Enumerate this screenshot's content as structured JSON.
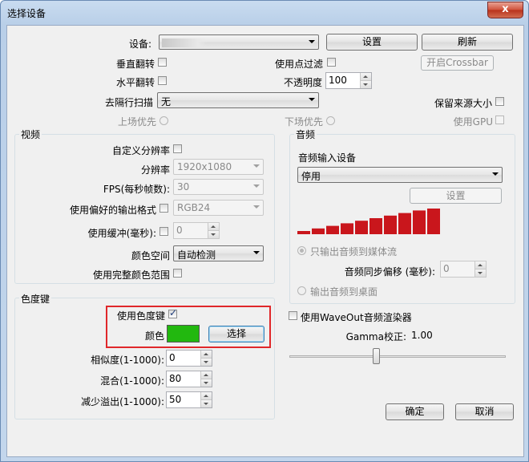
{
  "window": {
    "title": "选择设备",
    "close_glyph": "x"
  },
  "device": {
    "label": "设备:",
    "value": "",
    "settings_button": "设置",
    "refresh_button": "刷新",
    "crossbar_button": "开启Crossbar"
  },
  "options": {
    "flip_vertical": "垂直翻转",
    "flip_horizontal": "水平翻转",
    "use_point_filter": "使用点过滤",
    "opacity_label": "不透明度",
    "opacity_value": "100",
    "deinterlace_label": "去隔行扫描",
    "deinterlace_value": "无",
    "keep_source_size": "保留来源大小",
    "top_field_first": "上场优先",
    "bottom_field_first": "下场优先",
    "use_gpu": "使用GPU"
  },
  "video": {
    "group_label": "视频",
    "custom_resolution": "自定义分辨率",
    "resolution_label": "分辨率",
    "resolution_value": "1920x1080",
    "fps_label": "FPS(每秒帧数):",
    "fps_value": "30",
    "preferred_format_label": "使用偏好的输出格式",
    "preferred_format_value": "RGB24",
    "buffer_label": "使用缓冲(毫秒):",
    "buffer_value": "0",
    "color_space_label": "颜色空间",
    "color_space_value": "自动检测",
    "full_color_range": "使用完整颜色范围"
  },
  "audio": {
    "group_label": "音频",
    "input_device_label": "音频输入设备",
    "input_device_value": "停用",
    "settings_button": "设置",
    "output_stream_only": "只输出音频到媒体流",
    "sync_offset_label": "音频同步偏移 (毫秒):",
    "sync_offset_value": "0",
    "output_desktop": "输出音频到桌面",
    "level_bars": 10,
    "level_color": "#c9161c"
  },
  "chroma": {
    "group_label": "色度键",
    "use_chroma_key": "使用色度键",
    "color_label": "颜色",
    "color_value": "#22b80f",
    "select_button": "选择",
    "similarity_label": "相似度(1-1000):",
    "similarity_value": "0",
    "blend_label": "混合(1-1000):",
    "blend_value": "80",
    "spill_label": "减少溢出(1-1000):",
    "spill_value": "50",
    "highlight_color": "#e0272a"
  },
  "waveout": {
    "label": "使用WaveOut音频渲染器",
    "gamma_label": "Gamma校正:",
    "gamma_value": "1.00"
  },
  "footer": {
    "ok_button": "确定",
    "cancel_button": "取消"
  }
}
